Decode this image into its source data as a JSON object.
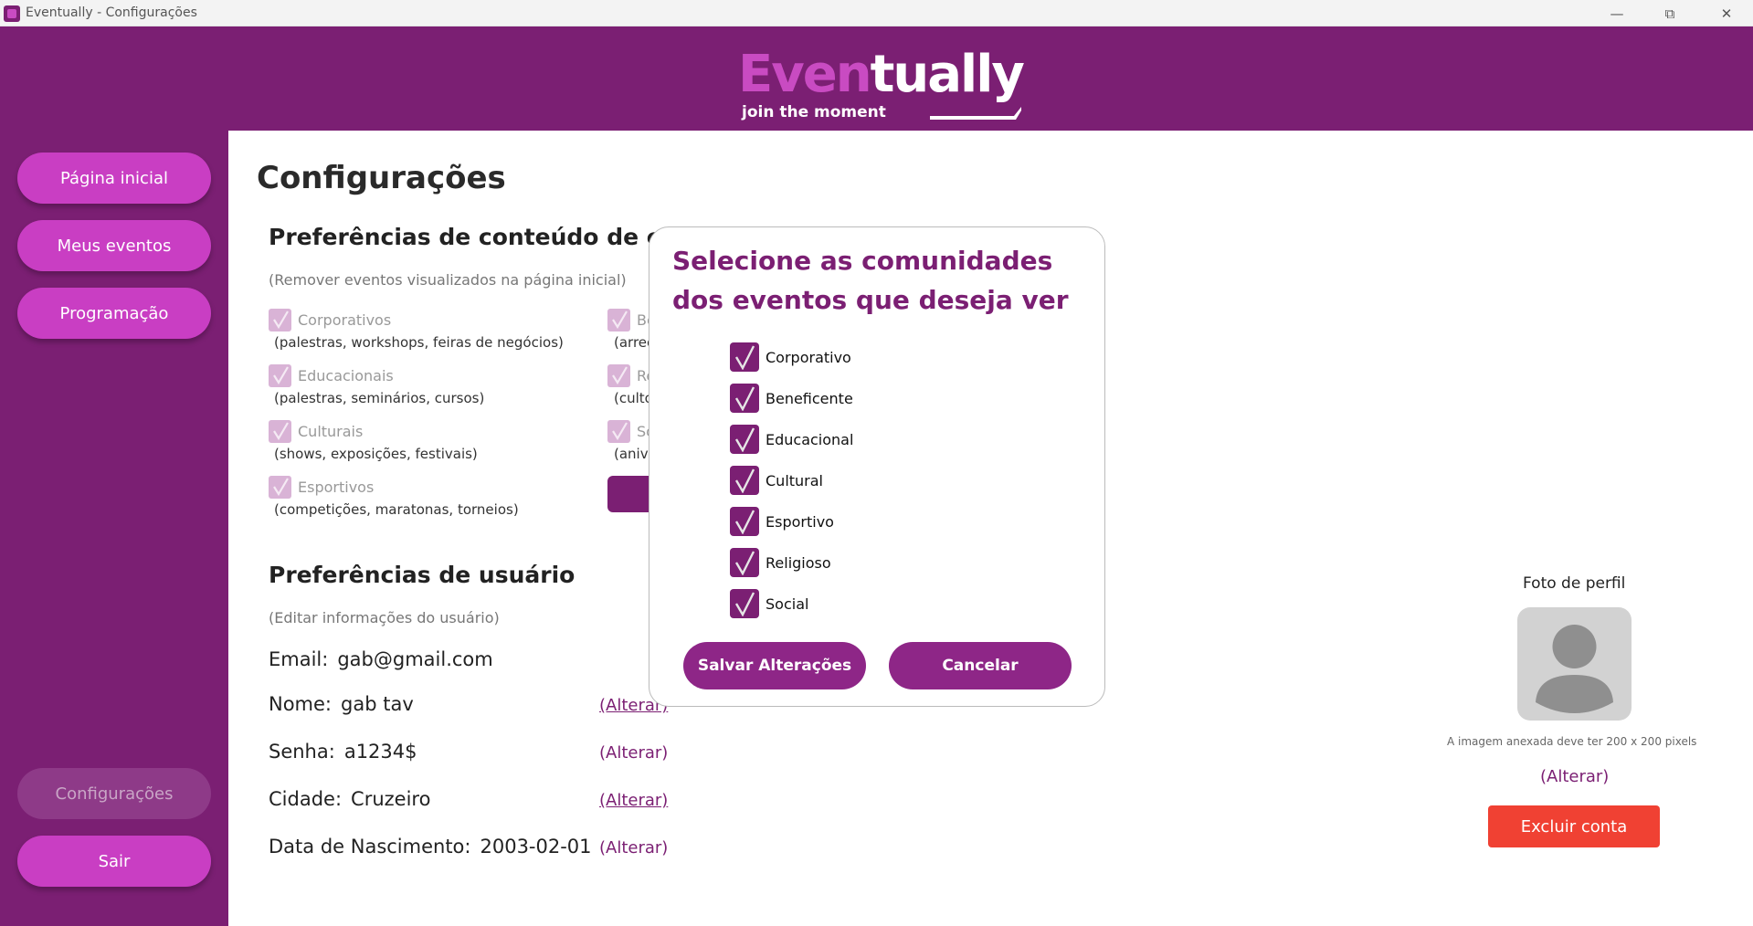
{
  "window": {
    "title": "Eventually - Configurações"
  },
  "logo": {
    "word_a": "Even",
    "word_b": "tually",
    "tagline": "join the moment"
  },
  "sidebar": {
    "items": [
      {
        "label": "Página inicial"
      },
      {
        "label": "Meus eventos"
      },
      {
        "label": "Programação"
      }
    ],
    "bottom": [
      {
        "label": "Configurações"
      },
      {
        "label": "Sair"
      }
    ]
  },
  "page": {
    "title": "Configurações"
  },
  "content_prefs": {
    "title": "Preferências de conteúdo de com",
    "hint": "(Remover eventos visualizados na página inicial)",
    "left": [
      {
        "label": "Corporativos",
        "desc": "(palestras, workshops, feiras de negócios)"
      },
      {
        "label": "Educacionais",
        "desc": "(palestras, seminários, cursos)"
      },
      {
        "label": "Culturais",
        "desc": "(shows, exposições, festivais)"
      },
      {
        "label": "Esportivos",
        "desc": "(competições, maratonas, torneios)"
      }
    ],
    "right": [
      {
        "label": "Be",
        "desc": "(arrec"
      },
      {
        "label": "Re",
        "desc": "(culto"
      },
      {
        "label": "So",
        "desc": "(anive"
      }
    ]
  },
  "user_prefs": {
    "title": "Preferências de usuário",
    "hint": "(Editar informações do usuário)",
    "fields": [
      {
        "label": "Email:",
        "value": "gab@gmail.com"
      },
      {
        "label": "Nome:",
        "value": "gab tav",
        "link": "(Alterar)"
      },
      {
        "label": "Senha:",
        "value": "a1234$",
        "link": "(Alterar)"
      },
      {
        "label": "Cidade:",
        "value": "Cruzeiro",
        "link": "(Alterar)"
      },
      {
        "label": "Data de Nascimento:",
        "value": "2003-02-01",
        "link": "(Alterar)"
      }
    ]
  },
  "profile": {
    "label": "Foto de perfil",
    "hint": "A imagem anexada deve ter 200 x 200 pixels",
    "alter": "(Alterar)",
    "delete": "Excluir conta"
  },
  "modal": {
    "title": "Selecione as comunidades dos eventos que deseja ver",
    "options": [
      {
        "label": "Corporativo",
        "checked": true
      },
      {
        "label": "Beneficente",
        "checked": true
      },
      {
        "label": "Educacional",
        "checked": true
      },
      {
        "label": "Cultural",
        "checked": true
      },
      {
        "label": "Esportivo",
        "checked": true
      },
      {
        "label": "Religioso",
        "checked": true
      },
      {
        "label": "Social",
        "checked": true
      }
    ],
    "save": "Salvar Alterações",
    "cancel": "Cancelar"
  },
  "colors": {
    "primary": "#7b1f73",
    "accent": "#c93ec3",
    "danger": "#f04133"
  }
}
